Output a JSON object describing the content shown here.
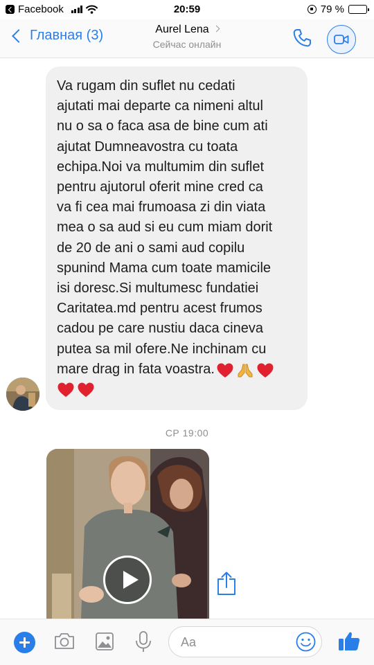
{
  "status_bar": {
    "back_app": "Facebook",
    "time": "20:59",
    "battery_percent": "79 %",
    "battery_level": 0.79
  },
  "nav": {
    "back_label": "Главная (3)",
    "contact_name": "Aurel Lena",
    "contact_status": "Сейчас онлайн"
  },
  "messages": [
    {
      "text": "Va rugam din suflet nu cedati\najutati mai departe ca nimeni altul\nnu o sa o faca asa de bine cum ati\najutat Dumneavostra cu toata\nechipa.Noi va multumim din suflet\npentru  ajutorul oferit mine cred ca\nva fi cea mai frumoasa zi din viata\nmea o sa aud si eu cum miam dorit\nde 20 de ani o sami aud copilu\nspunind Mama cum toate mamicile\nisi doresc.Si multumesc fundatiei\nCaritatea.md pentru acest frumos\ncadou pe care nustiu daca cineva\nputea sa mil ofere.Ne inchinam cu\nmare drag in fata voastra.",
      "inline_emoji": [
        "red-heart",
        "folded-hands",
        "red-heart"
      ],
      "trailing_emoji": [
        "red-heart",
        "red-heart"
      ]
    }
  ],
  "timestamp": "СР 19:00",
  "composer": {
    "placeholder": "Aa"
  },
  "colors": {
    "accent": "#2a7ee8",
    "bubble": "#f1f0f0",
    "muted_text": "#8e8e93"
  },
  "icons": {
    "back": "chevron-left-icon",
    "call": "phone-icon",
    "video_call": "video-camera-icon",
    "play": "play-icon",
    "share": "share-icon",
    "add": "plus-icon",
    "camera": "camera-icon",
    "gallery": "image-icon",
    "voice": "microphone-icon",
    "emoji": "smiley-icon",
    "like": "thumbs-up-icon"
  }
}
